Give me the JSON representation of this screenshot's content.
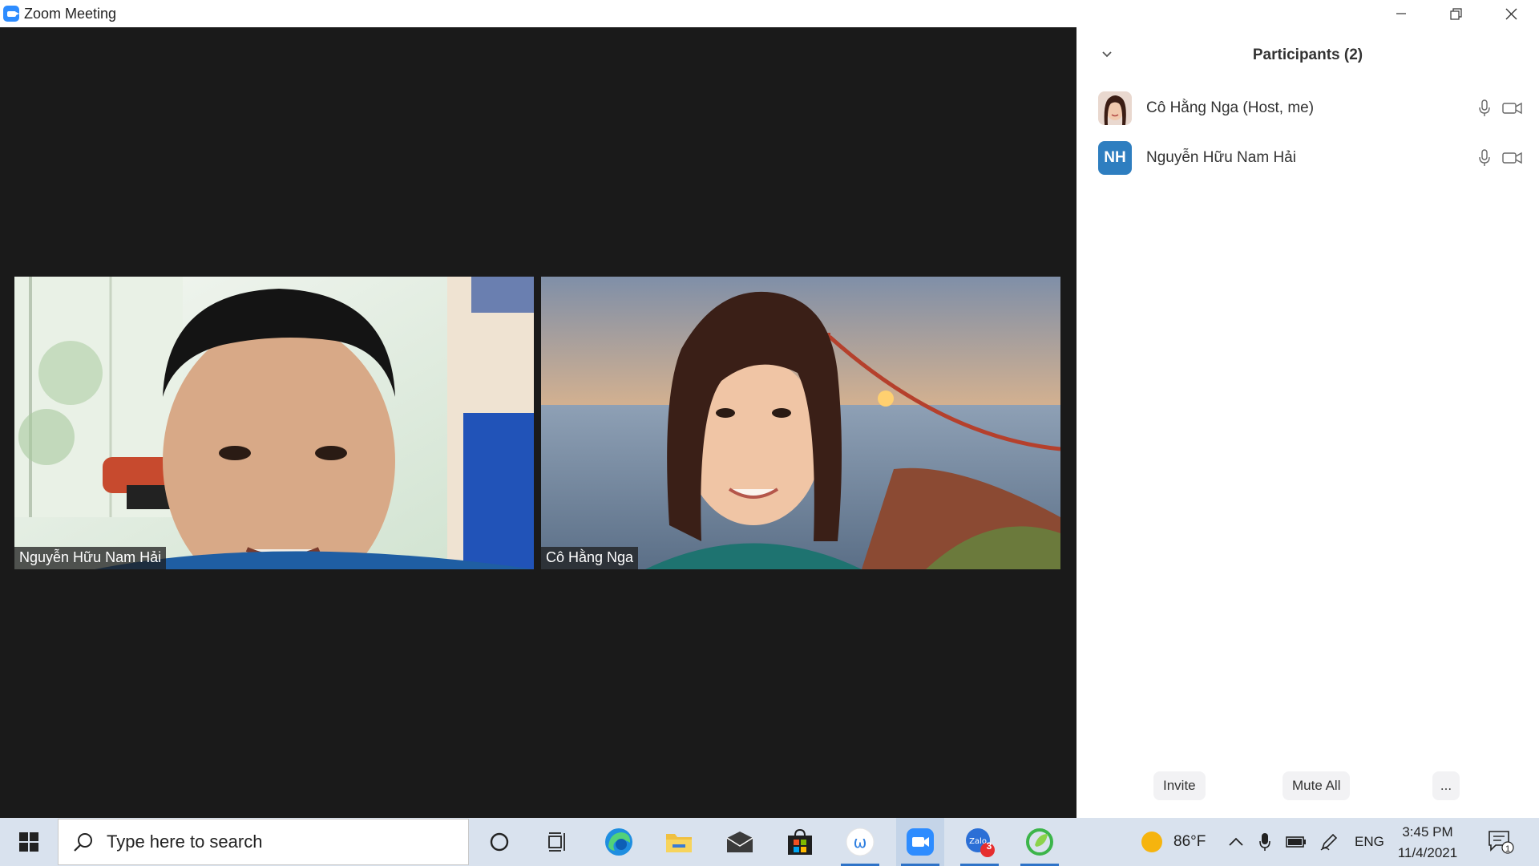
{
  "window": {
    "title": "Zoom Meeting"
  },
  "videos": [
    {
      "name": "Nguyễn Hữu Nam Hải"
    },
    {
      "name": "Cô Hằng Nga"
    }
  ],
  "participants": {
    "title": "Participants (2)",
    "list": [
      {
        "name": "Cô Hằng Nga (Host, me)",
        "avatar": "photo"
      },
      {
        "name": "Nguyễn Hữu Nam Hải",
        "initials": "NH"
      }
    ],
    "buttons": {
      "invite": "Invite",
      "mute_all": "Mute All",
      "more": "..."
    }
  },
  "taskbar": {
    "search_placeholder": "Type here to search",
    "weather": "86°F",
    "language": "ENG",
    "time": "3:45 PM",
    "date": "11/4/2021",
    "zalo_badge": "3",
    "notification_count": "1"
  },
  "colors": {
    "zoom_blue": "#2D8CFF",
    "meeting_bg": "#1a1a1a",
    "initials_avatar": "#2E7EC0",
    "taskbar_bg": "#d9e2ee"
  }
}
